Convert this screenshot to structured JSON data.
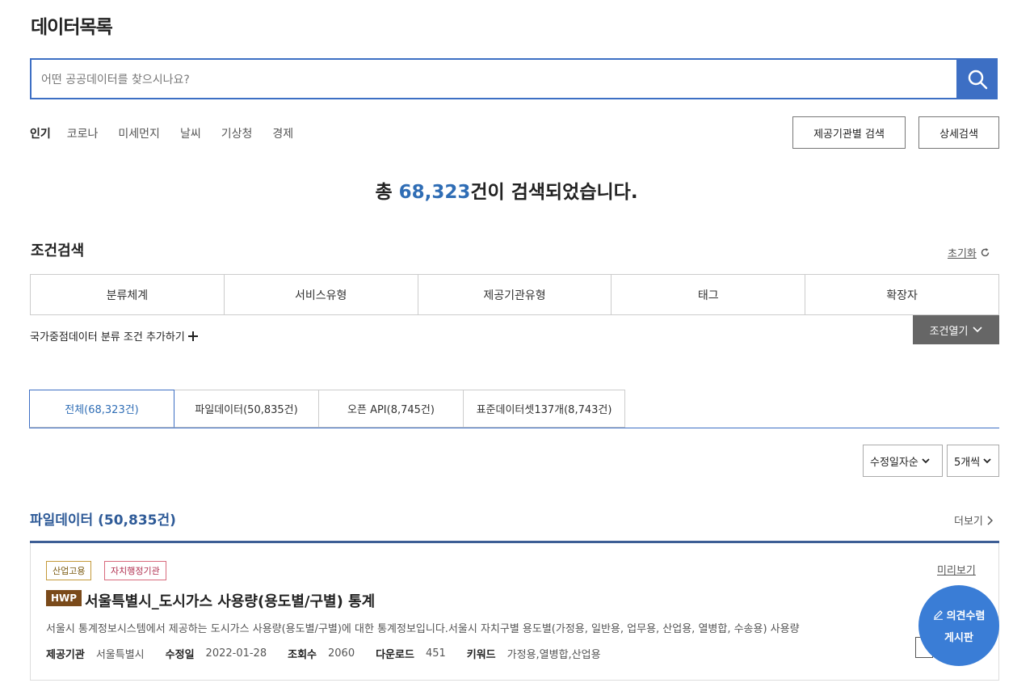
{
  "page": {
    "title": "데이터목록"
  },
  "search": {
    "placeholder": "어떤 공공데이터를 찾으시나요?",
    "icon": "search-icon"
  },
  "keywords": {
    "label": "인기",
    "items": [
      "코로나",
      "미세먼지",
      "날씨",
      "기상청",
      "경제"
    ]
  },
  "buttons": {
    "org_search": "제공기관별 검색",
    "detail_search": "상세검색"
  },
  "total": {
    "prefix": "총 ",
    "count": "68,323",
    "suffix": "건이 검색되었습니다."
  },
  "conditions": {
    "title": "조건검색",
    "reset": "초기화",
    "filters": [
      "분류체계",
      "서비스유형",
      "제공기관유형",
      "태그",
      "확장자"
    ],
    "national_add": "국가중점데이터 분류 조건 추가하기",
    "open": "조건열기"
  },
  "tabs": [
    "전체(68,323건)",
    "파일데이터(50,835건)",
    "오픈 API(8,745건)",
    "표준데이터셋137개(8,743건)"
  ],
  "sort": {
    "selected": "수정일자순",
    "count_selected": "5개씩"
  },
  "section": {
    "title": "파일데이터 (50,835건)",
    "more": "더보기"
  },
  "item": {
    "badges": [
      "산업고용",
      "자치행정기관"
    ],
    "preview": "미리보기",
    "format": "HWP",
    "title": "서울특별시_도시가스 사용량(용도별/구별) 통계",
    "description": "서울시 통계정보시스템에서 제공하는 도시가스 사용량(용도별/구별)에 대한 통계정보입니다.서울시 자치구별 용도별(가정용, 일반용, 업무용, 산업용, 열병합, 수송용) 사용량",
    "meta": {
      "org_label": "제공기관",
      "org": "서울특별시",
      "date_label": "수정일",
      "date": "2022-01-28",
      "views_label": "조회수",
      "views": "2060",
      "downloads_label": "다운로드",
      "downloads": "451",
      "keywords_label": "키워드",
      "keywords": "가정용,열병합,산업용"
    }
  },
  "fab": {
    "line1": "의견수렴",
    "line2": "게시판"
  },
  "colors": {
    "accent": "#3d6fc4",
    "title_blue": "#2f5b98",
    "fab": "#3a7dd6"
  }
}
